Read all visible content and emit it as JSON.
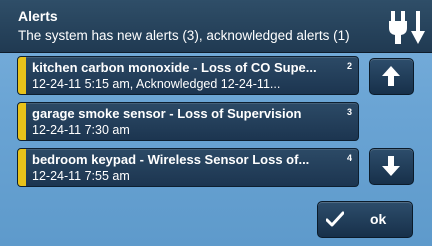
{
  "header": {
    "title": "Alerts",
    "subtitle": "The system has new alerts (3), acknowledged alerts (1)",
    "status_icon": "power-plug-icon"
  },
  "alerts": [
    {
      "title": "kitchen carbon monoxide - Loss of CO Supe...",
      "detail": "12-24-11 5:15 am, Acknowledged 12-24-11...",
      "index": "2",
      "stripe_color": "#e8c21a"
    },
    {
      "title": "garage smoke sensor - Loss of Supervision",
      "detail": "12-24-11 7:30 am",
      "index": "3",
      "stripe_color": "#e8c21a"
    },
    {
      "title": "bedroom keypad  - Wireless Sensor Loss of...",
      "detail": "12-24-11 7:55 am",
      "index": "4",
      "stripe_color": "#e8c21a"
    }
  ],
  "nav": {
    "up_icon": "arrow-up-icon",
    "down_icon": "arrow-down-icon"
  },
  "ok_button": {
    "label": "ok",
    "icon": "checkmark-icon"
  },
  "colors": {
    "background": "#6aa4d4",
    "header": "#243f58",
    "item": "#22405c",
    "stripe": "#e8c21a"
  }
}
